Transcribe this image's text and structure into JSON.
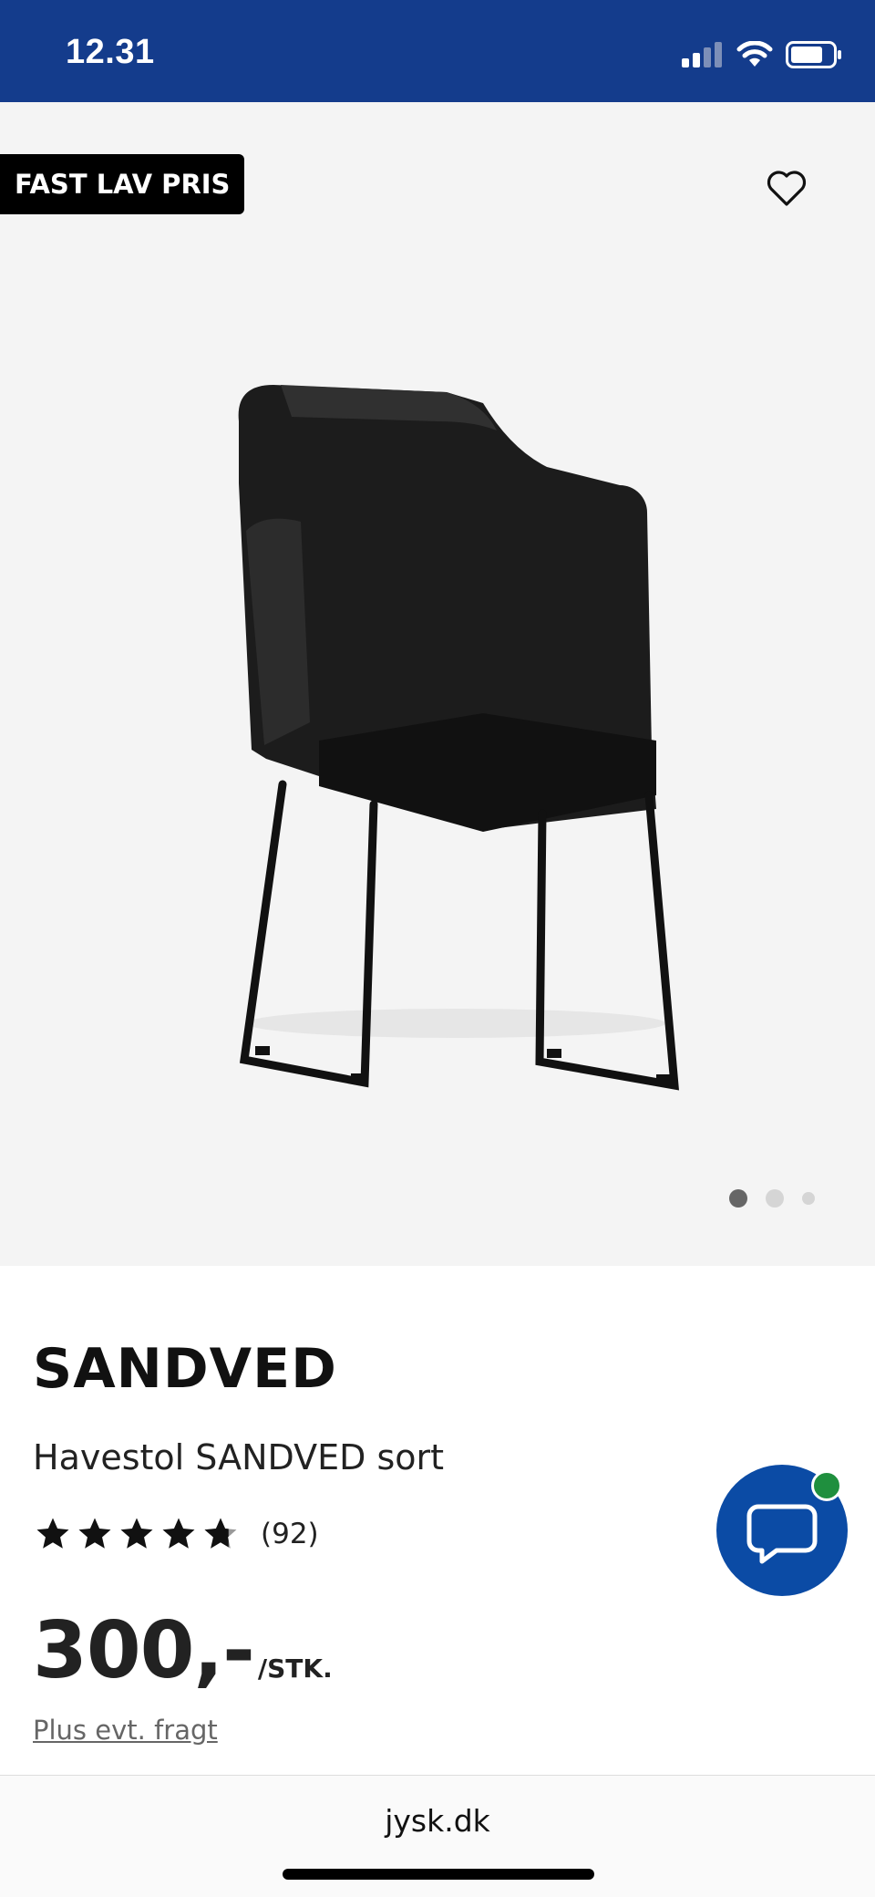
{
  "status_bar": {
    "time": "12.31"
  },
  "hero": {
    "badge": "FAST LAV PRIS",
    "image_alt": "Black armchair SANDVED",
    "carousel": {
      "count": 3,
      "active": 0
    }
  },
  "product": {
    "brand": "SANDVED",
    "name": "Havestol SANDVED sort",
    "rating": {
      "stars": 4.7,
      "count": "(92)"
    },
    "price": "300,-",
    "unit": "/STK.",
    "shipping": "Plus evt. fragt"
  },
  "browser": {
    "url": "jysk.dk"
  },
  "colors": {
    "brand_blue": "#143c8c",
    "chat_blue": "#0b4ba5",
    "online_green": "#1f8f3e"
  }
}
